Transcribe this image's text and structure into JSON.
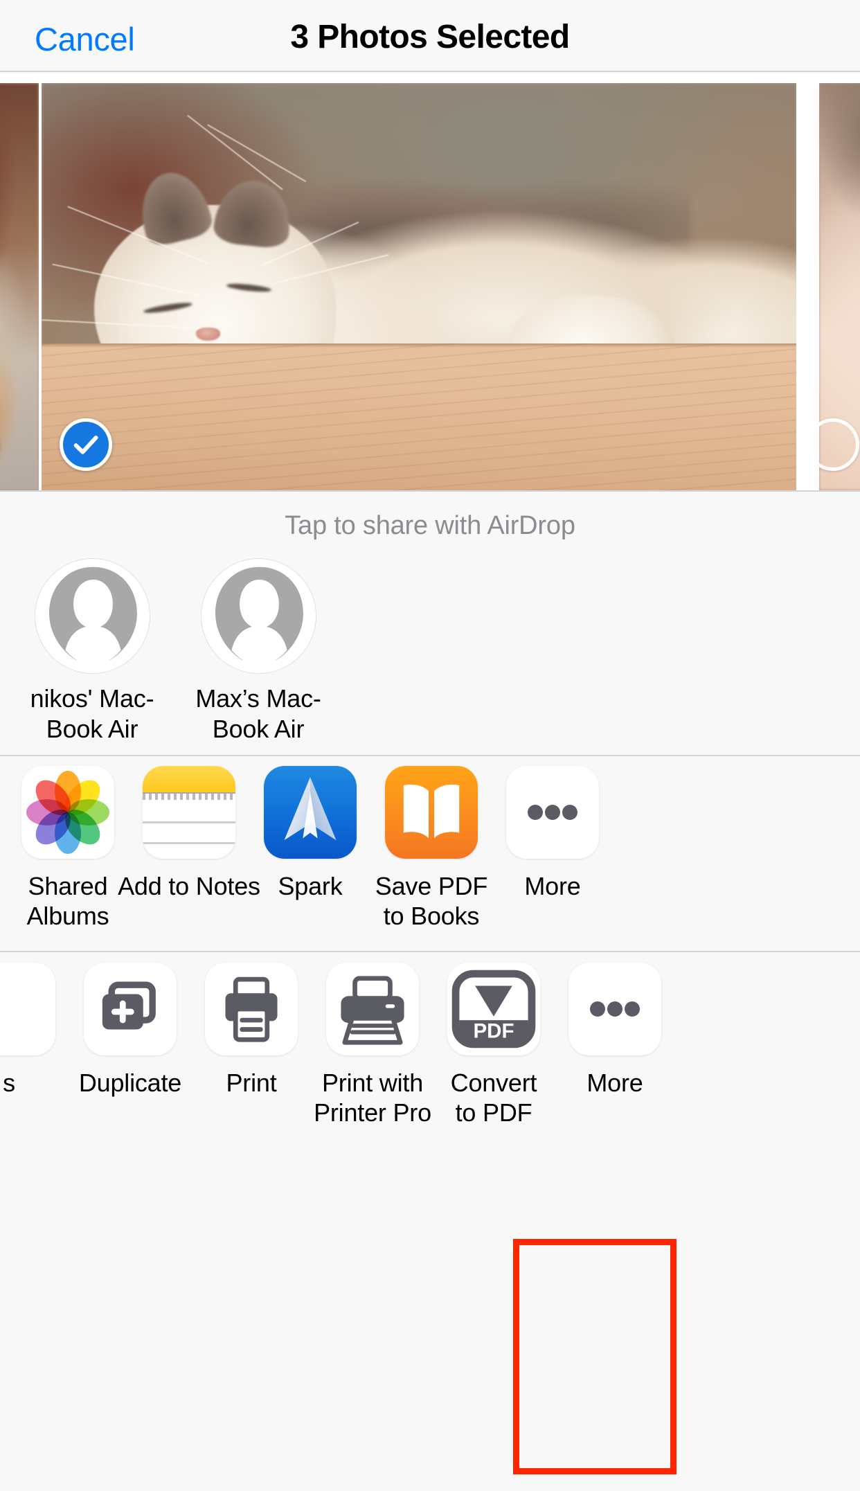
{
  "navbar": {
    "cancel_label": "Cancel",
    "title": "3 Photos Selected"
  },
  "photo_strip": {
    "selected_count": 3,
    "thumbnails": [
      {
        "name": "photo-thumbnail-previous",
        "selected": true,
        "partial": true,
        "subject": "blurred warm interior"
      },
      {
        "name": "photo-thumbnail-current",
        "selected": true,
        "partial": false,
        "subject": "sleeping white cat on wooden board"
      },
      {
        "name": "photo-thumbnail-next",
        "selected": true,
        "partial": true,
        "subject": "cat fur close-up"
      }
    ],
    "checkmark_color": "#1578e0"
  },
  "airdrop": {
    "hint": "Tap to share with AirDrop",
    "contacts": [
      {
        "label": "nikos' Mac-\nBook Air",
        "icon": "person-avatar-icon"
      },
      {
        "label": "Max’s Mac-\nBook Air",
        "icon": "person-avatar-icon"
      }
    ]
  },
  "app_row": {
    "items": [
      {
        "label": "Shared\nAlbums",
        "icon": "photos-app-icon"
      },
      {
        "label": "Add to Notes",
        "icon": "notes-app-icon"
      },
      {
        "label": "Spark",
        "icon": "spark-app-icon"
      },
      {
        "label": "Save PDF\nto Books",
        "icon": "books-app-icon"
      },
      {
        "label": "More",
        "icon": "ellipsis-icon"
      }
    ]
  },
  "action_row": {
    "items": [
      {
        "label": "s",
        "icon": "cut-off-action-icon",
        "partial": true
      },
      {
        "label": "Duplicate",
        "icon": "duplicate-icon"
      },
      {
        "label": "Print",
        "icon": "printer-icon"
      },
      {
        "label": "Print with\nPrinter Pro",
        "icon": "printer-pro-icon"
      },
      {
        "label": "Convert\nto PDF",
        "icon": "convert-to-pdf-icon",
        "highlighted": true
      },
      {
        "label": "More",
        "icon": "ellipsis-icon"
      }
    ],
    "pdf_icon_text": "PDF"
  },
  "annotation": {
    "highlight_color": "#fe2600",
    "target": "Convert to PDF"
  }
}
